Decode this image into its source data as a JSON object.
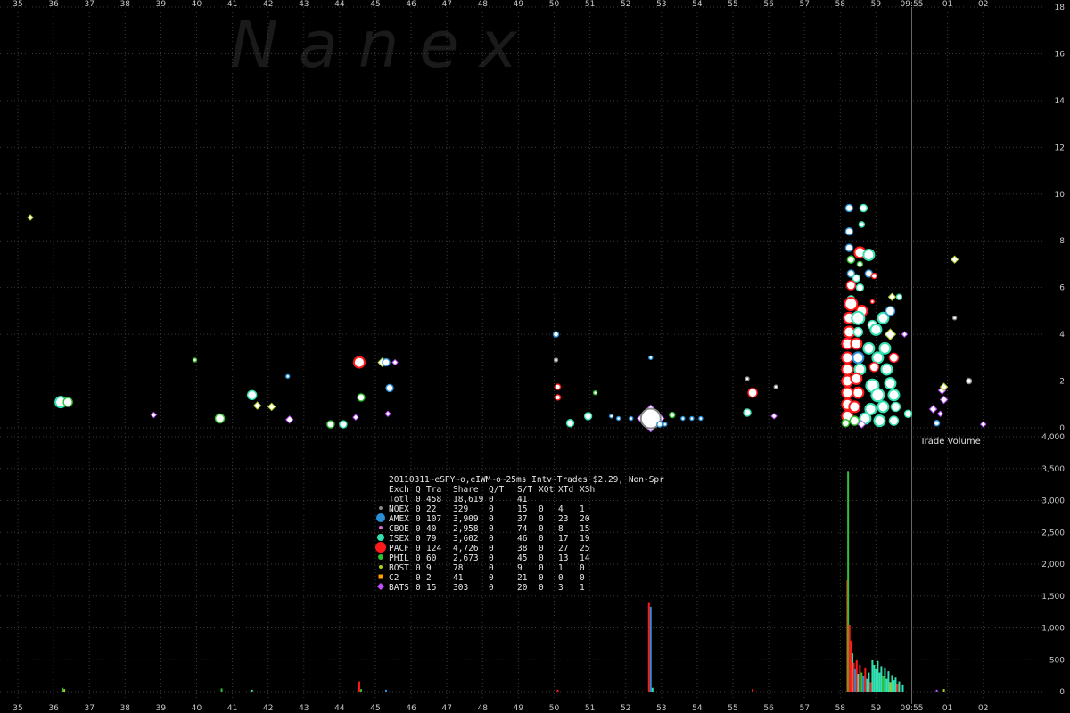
{
  "watermark": "N a n e x",
  "chart_data": {
    "type": "scatter",
    "title": "20110311~eSPY~o,eIWM~o~25ms Intv~Trades $2.29, Non-Spr",
    "time_axis": {
      "ticks": [
        "35",
        "36",
        "37",
        "38",
        "39",
        "40",
        "41",
        "42",
        "43",
        "44",
        "45",
        "46",
        "47",
        "48",
        "49",
        "50",
        "51",
        "52",
        "53",
        "54",
        "55",
        "56",
        "57",
        "58",
        "59",
        "09:55",
        "01",
        "02"
      ],
      "start_minute": 35,
      "end_minute": 62.3
    },
    "price_axis": {
      "ticks": [
        "0",
        "2",
        "4",
        "6",
        "8",
        "10",
        "12",
        "14",
        "16",
        "18"
      ],
      "ylim": [
        0,
        18
      ]
    },
    "volume_axis": {
      "label": "Trade Volume",
      "ticks": [
        "0",
        "500",
        "1,000",
        "1,500",
        "2,000",
        "2,500",
        "3,000",
        "3,500",
        "4,000"
      ],
      "ylim": [
        0,
        4000
      ]
    },
    "exchanges": [
      {
        "code": "NQEX",
        "color": "#888888",
        "size": 3
      },
      {
        "code": "AMEX",
        "color": "#2a8fd6",
        "size": 6
      },
      {
        "code": "CBOE",
        "color": "#d66ad6",
        "size": 3
      },
      {
        "code": "ISEX",
        "color": "#33e0b0",
        "size": 5
      },
      {
        "code": "PACF",
        "color": "#ff1a1a",
        "size": 7
      },
      {
        "code": "PHIL",
        "color": "#2ec22e",
        "size": 4
      },
      {
        "code": "BOST",
        "color": "#b0d020",
        "size": 3
      },
      {
        "code": "C2",
        "color": "#ffa000",
        "size": 3
      },
      {
        "code": "BATS",
        "color": "#c050ff",
        "size": 3
      }
    ],
    "stats": {
      "header": [
        "Exch",
        "Q",
        "Tra",
        "Share",
        "Q/T",
        "S/T",
        "XQt",
        "XTd",
        "XSh"
      ],
      "rows": [
        [
          "Totl",
          "0",
          "458",
          "18,619",
          "0",
          "41",
          "",
          "",
          ""
        ],
        [
          "NQEX",
          "0",
          "22",
          "329",
          "0",
          "15",
          "0",
          "4",
          "1"
        ],
        [
          "AMEX",
          "0",
          "107",
          "3,909",
          "0",
          "37",
          "0",
          "23",
          "20"
        ],
        [
          "CBOE",
          "0",
          "40",
          "2,958",
          "0",
          "74",
          "0",
          "8",
          "15"
        ],
        [
          "ISEX",
          "0",
          "79",
          "3,602",
          "0",
          "46",
          "0",
          "17",
          "19"
        ],
        [
          "PACF",
          "0",
          "124",
          "4,726",
          "0",
          "38",
          "0",
          "27",
          "25"
        ],
        [
          "PHIL",
          "0",
          "60",
          "2,673",
          "0",
          "45",
          "0",
          "13",
          "14"
        ],
        [
          "BOST",
          "0",
          "9",
          "78",
          "0",
          "9",
          "0",
          "1",
          "0"
        ],
        [
          "C2",
          "0",
          "2",
          "41",
          "0",
          "21",
          "0",
          "0",
          "0"
        ],
        [
          "BATS",
          "0",
          "15",
          "303",
          "0",
          "20",
          "0",
          "3",
          "1"
        ]
      ]
    },
    "price_points": [
      {
        "t": 35.35,
        "p": 9.0,
        "ex": "BOST",
        "s": 2
      },
      {
        "t": 36.2,
        "p": 1.1,
        "ex": "ISEX",
        "s": 6
      },
      {
        "t": 36.4,
        "p": 1.1,
        "ex": "PHIL",
        "s": 5
      },
      {
        "t": 38.8,
        "p": 0.55,
        "ex": "BATS",
        "s": 2
      },
      {
        "t": 39.95,
        "p": 2.9,
        "ex": "PHIL",
        "s": 2
      },
      {
        "t": 40.65,
        "p": 0.4,
        "ex": "PHIL",
        "s": 5
      },
      {
        "t": 41.55,
        "p": 1.4,
        "ex": "ISEX",
        "s": 5
      },
      {
        "t": 41.7,
        "p": 0.95,
        "ex": "BOST",
        "s": 3
      },
      {
        "t": 42.1,
        "p": 0.9,
        "ex": "BOST",
        "s": 3
      },
      {
        "t": 42.55,
        "p": 2.2,
        "ex": "AMEX",
        "s": 2
      },
      {
        "t": 42.6,
        "p": 0.35,
        "ex": "BATS",
        "s": 3
      },
      {
        "t": 43.75,
        "p": 0.15,
        "ex": "PHIL",
        "s": 4
      },
      {
        "t": 44.1,
        "p": 0.15,
        "ex": "ISEX",
        "s": 4
      },
      {
        "t": 44.45,
        "p": 0.45,
        "ex": "BATS",
        "s": 2
      },
      {
        "t": 44.55,
        "p": 2.8,
        "ex": "PACF",
        "s": 6
      },
      {
        "t": 44.6,
        "p": 1.3,
        "ex": "PHIL",
        "s": 4
      },
      {
        "t": 45.2,
        "p": 2.8,
        "ex": "BOST",
        "s": 4
      },
      {
        "t": 45.3,
        "p": 2.8,
        "ex": "AMEX",
        "s": 4
      },
      {
        "t": 45.4,
        "p": 1.7,
        "ex": "AMEX",
        "s": 4
      },
      {
        "t": 45.35,
        "p": 0.6,
        "ex": "BATS",
        "s": 2
      },
      {
        "t": 45.55,
        "p": 2.8,
        "ex": "BATS",
        "s": 2
      },
      {
        "t": 50.05,
        "p": 4.0,
        "ex": "AMEX",
        "s": 3
      },
      {
        "t": 50.05,
        "p": 2.9,
        "ex": "NQEX",
        "s": 2
      },
      {
        "t": 50.1,
        "p": 1.75,
        "ex": "PACF",
        "s": 3
      },
      {
        "t": 50.1,
        "p": 1.3,
        "ex": "PACF",
        "s": 3
      },
      {
        "t": 50.45,
        "p": 0.2,
        "ex": "ISEX",
        "s": 4
      },
      {
        "t": 50.95,
        "p": 0.5,
        "ex": "ISEX",
        "s": 4
      },
      {
        "t": 51.15,
        "p": 1.5,
        "ex": "PHIL",
        "s": 2
      },
      {
        "t": 51.6,
        "p": 0.5,
        "ex": "AMEX",
        "s": 2
      },
      {
        "t": 51.8,
        "p": 0.4,
        "ex": "AMEX",
        "s": 2
      },
      {
        "t": 52.15,
        "p": 0.4,
        "ex": "AMEX",
        "s": 2
      },
      {
        "t": 52.7,
        "p": 0.4,
        "ex": "BATS",
        "s": 14
      },
      {
        "t": 52.7,
        "p": 0.4,
        "ex": "NQEX",
        "s": 11
      },
      {
        "t": 52.7,
        "p": 3.0,
        "ex": "AMEX",
        "s": 2
      },
      {
        "t": 52.95,
        "p": 0.15,
        "ex": "AMEX",
        "s": 3
      },
      {
        "t": 53.1,
        "p": 0.15,
        "ex": "AMEX",
        "s": 2
      },
      {
        "t": 53.3,
        "p": 0.55,
        "ex": "PHIL",
        "s": 3
      },
      {
        "t": 53.6,
        "p": 0.4,
        "ex": "AMEX",
        "s": 2
      },
      {
        "t": 53.85,
        "p": 0.4,
        "ex": "AMEX",
        "s": 2
      },
      {
        "t": 54.1,
        "p": 0.4,
        "ex": "AMEX",
        "s": 2
      },
      {
        "t": 55.4,
        "p": 0.65,
        "ex": "ISEX",
        "s": 4
      },
      {
        "t": 55.4,
        "p": 2.1,
        "ex": "NQEX",
        "s": 2
      },
      {
        "t": 55.55,
        "p": 1.5,
        "ex": "PACF",
        "s": 5
      },
      {
        "t": 56.15,
        "p": 0.5,
        "ex": "BATS",
        "s": 2
      },
      {
        "t": 56.2,
        "p": 1.75,
        "ex": "NQEX",
        "s": 2
      },
      {
        "t": 58.25,
        "p": 9.4,
        "ex": "AMEX",
        "s": 4
      },
      {
        "t": 58.65,
        "p": 9.4,
        "ex": "ISEX",
        "s": 4
      },
      {
        "t": 58.6,
        "p": 8.7,
        "ex": "ISEX",
        "s": 3
      },
      {
        "t": 58.25,
        "p": 8.4,
        "ex": "AMEX",
        "s": 4
      },
      {
        "t": 58.25,
        "p": 7.7,
        "ex": "AMEX",
        "s": 4
      },
      {
        "t": 58.55,
        "p": 7.5,
        "ex": "PACF",
        "s": 6
      },
      {
        "t": 58.8,
        "p": 7.4,
        "ex": "ISEX",
        "s": 6
      },
      {
        "t": 58.3,
        "p": 7.2,
        "ex": "PHIL",
        "s": 4
      },
      {
        "t": 58.55,
        "p": 7.0,
        "ex": "PHIL",
        "s": 3
      },
      {
        "t": 58.3,
        "p": 6.6,
        "ex": "AMEX",
        "s": 4
      },
      {
        "t": 58.8,
        "p": 6.6,
        "ex": "AMEX",
        "s": 4
      },
      {
        "t": 58.95,
        "p": 6.5,
        "ex": "PACF",
        "s": 3
      },
      {
        "t": 58.45,
        "p": 6.4,
        "ex": "ISEX",
        "s": 4
      },
      {
        "t": 58.3,
        "p": 6.1,
        "ex": "PACF",
        "s": 5
      },
      {
        "t": 58.55,
        "p": 6.0,
        "ex": "ISEX",
        "s": 4
      },
      {
        "t": 58.3,
        "p": 5.5,
        "ex": "ISEX",
        "s": 4
      },
      {
        "t": 58.9,
        "p": 5.4,
        "ex": "PACF",
        "s": 2
      },
      {
        "t": 59.45,
        "p": 5.6,
        "ex": "BOST",
        "s": 3
      },
      {
        "t": 59.65,
        "p": 5.6,
        "ex": "ISEX",
        "s": 3
      },
      {
        "t": 58.3,
        "p": 5.3,
        "ex": "PACF",
        "s": 7
      },
      {
        "t": 58.6,
        "p": 5.0,
        "ex": "PACF",
        "s": 6
      },
      {
        "t": 58.25,
        "p": 4.7,
        "ex": "PACF",
        "s": 6
      },
      {
        "t": 58.5,
        "p": 4.7,
        "ex": "ISEX",
        "s": 7
      },
      {
        "t": 59.2,
        "p": 4.7,
        "ex": "ISEX",
        "s": 6
      },
      {
        "t": 59.4,
        "p": 5.0,
        "ex": "AMEX",
        "s": 5
      },
      {
        "t": 58.9,
        "p": 4.4,
        "ex": "ISEX",
        "s": 5
      },
      {
        "t": 58.25,
        "p": 4.1,
        "ex": "PACF",
        "s": 6
      },
      {
        "t": 58.5,
        "p": 4.1,
        "ex": "ISEX",
        "s": 5
      },
      {
        "t": 59.0,
        "p": 4.2,
        "ex": "ISEX",
        "s": 6
      },
      {
        "t": 59.4,
        "p": 4.0,
        "ex": "BOST",
        "s": 5
      },
      {
        "t": 59.8,
        "p": 4.0,
        "ex": "BATS",
        "s": 2
      },
      {
        "t": 58.2,
        "p": 3.6,
        "ex": "PACF",
        "s": 6
      },
      {
        "t": 58.45,
        "p": 3.6,
        "ex": "PACF",
        "s": 6
      },
      {
        "t": 58.8,
        "p": 3.4,
        "ex": "ISEX",
        "s": 6
      },
      {
        "t": 59.25,
        "p": 3.4,
        "ex": "ISEX",
        "s": 6
      },
      {
        "t": 58.2,
        "p": 3.0,
        "ex": "PACF",
        "s": 6
      },
      {
        "t": 58.5,
        "p": 3.0,
        "ex": "AMEX",
        "s": 6
      },
      {
        "t": 59.05,
        "p": 3.0,
        "ex": "ISEX",
        "s": 6
      },
      {
        "t": 59.5,
        "p": 3.0,
        "ex": "PACF",
        "s": 5
      },
      {
        "t": 58.2,
        "p": 2.5,
        "ex": "PACF",
        "s": 6
      },
      {
        "t": 58.55,
        "p": 2.5,
        "ex": "ISEX",
        "s": 6
      },
      {
        "t": 58.95,
        "p": 2.6,
        "ex": "PACF",
        "s": 5
      },
      {
        "t": 59.3,
        "p": 2.5,
        "ex": "ISEX",
        "s": 6
      },
      {
        "t": 58.2,
        "p": 2.0,
        "ex": "PACF",
        "s": 6
      },
      {
        "t": 58.45,
        "p": 2.1,
        "ex": "PACF",
        "s": 6
      },
      {
        "t": 58.9,
        "p": 1.8,
        "ex": "ISEX",
        "s": 7
      },
      {
        "t": 59.4,
        "p": 1.9,
        "ex": "ISEX",
        "s": 6
      },
      {
        "t": 58.2,
        "p": 1.5,
        "ex": "PACF",
        "s": 6
      },
      {
        "t": 58.5,
        "p": 1.5,
        "ex": "PACF",
        "s": 6
      },
      {
        "t": 59.05,
        "p": 1.4,
        "ex": "ISEX",
        "s": 7
      },
      {
        "t": 59.5,
        "p": 1.4,
        "ex": "ISEX",
        "s": 6
      },
      {
        "t": 58.2,
        "p": 1.0,
        "ex": "PACF",
        "s": 6
      },
      {
        "t": 58.4,
        "p": 0.9,
        "ex": "PACF",
        "s": 6
      },
      {
        "t": 58.85,
        "p": 0.8,
        "ex": "ISEX",
        "s": 6
      },
      {
        "t": 59.2,
        "p": 0.9,
        "ex": "ISEX",
        "s": 6
      },
      {
        "t": 59.55,
        "p": 0.9,
        "ex": "ISEX",
        "s": 5
      },
      {
        "t": 58.2,
        "p": 0.5,
        "ex": "PACF",
        "s": 6
      },
      {
        "t": 58.4,
        "p": 0.3,
        "ex": "PHIL",
        "s": 5
      },
      {
        "t": 58.7,
        "p": 0.4,
        "ex": "ISEX",
        "s": 6
      },
      {
        "t": 59.1,
        "p": 0.3,
        "ex": "ISEX",
        "s": 6
      },
      {
        "t": 59.5,
        "p": 0.3,
        "ex": "ISEX",
        "s": 5
      },
      {
        "t": 58.15,
        "p": 0.2,
        "ex": "PHIL",
        "s": 4
      },
      {
        "t": 58.6,
        "p": 0.15,
        "ex": "BATS",
        "s": 3
      },
      {
        "t": 59.9,
        "p": 0.6,
        "ex": "ISEX",
        "s": 4
      },
      {
        "t": 60.6,
        "p": 0.8,
        "ex": "BATS",
        "s": 3
      },
      {
        "t": 60.7,
        "p": 0.2,
        "ex": "AMEX",
        "s": 3
      },
      {
        "t": 60.8,
        "p": 0.6,
        "ex": "BATS",
        "s": 2
      },
      {
        "t": 60.85,
        "p": 1.6,
        "ex": "BATS",
        "s": 3
      },
      {
        "t": 60.9,
        "p": 1.75,
        "ex": "BOST",
        "s": 3
      },
      {
        "t": 60.9,
        "p": 1.2,
        "ex": "BATS",
        "s": 3
      },
      {
        "t": 61.2,
        "p": 7.2,
        "ex": "BOST",
        "s": 3
      },
      {
        "t": 61.2,
        "p": 4.7,
        "ex": "NQEX",
        "s": 2
      },
      {
        "t": 61.6,
        "p": 2.0,
        "ex": "NQEX",
        "s": 3
      },
      {
        "t": 62.0,
        "p": 0.15,
        "ex": "BATS",
        "s": 2
      }
    ],
    "volume_bars": [
      {
        "t": 36.25,
        "v": 60,
        "ex": "PHIL"
      },
      {
        "t": 36.3,
        "v": 40,
        "ex": "BOST"
      },
      {
        "t": 40.7,
        "v": 50,
        "ex": "PHIL"
      },
      {
        "t": 41.55,
        "v": 30,
        "ex": "ISEX"
      },
      {
        "t": 44.55,
        "v": 160,
        "ex": "PACF"
      },
      {
        "t": 44.6,
        "v": 40,
        "ex": "PHIL"
      },
      {
        "t": 45.3,
        "v": 30,
        "ex": "AMEX"
      },
      {
        "t": 50.1,
        "v": 30,
        "ex": "PACF"
      },
      {
        "t": 52.65,
        "v": 1390,
        "ex": "PACF"
      },
      {
        "t": 52.7,
        "v": 1330,
        "ex": "AMEX"
      },
      {
        "t": 52.75,
        "v": 60,
        "ex": "ISEX"
      },
      {
        "t": 55.55,
        "v": 40,
        "ex": "PACF"
      },
      {
        "t": 58.2,
        "v": 1750,
        "ex": "PACF"
      },
      {
        "t": 58.22,
        "v": 3450,
        "ex": "PHIL"
      },
      {
        "t": 58.26,
        "v": 1050,
        "ex": "PACF"
      },
      {
        "t": 58.3,
        "v": 800,
        "ex": "PACF"
      },
      {
        "t": 58.34,
        "v": 600,
        "ex": "ISEX"
      },
      {
        "t": 58.38,
        "v": 450,
        "ex": "PACF"
      },
      {
        "t": 58.42,
        "v": 350,
        "ex": "AMEX"
      },
      {
        "t": 58.46,
        "v": 500,
        "ex": "PACF"
      },
      {
        "t": 58.5,
        "v": 280,
        "ex": "ISEX"
      },
      {
        "t": 58.55,
        "v": 420,
        "ex": "PACF"
      },
      {
        "t": 58.6,
        "v": 300,
        "ex": "PHIL"
      },
      {
        "t": 58.65,
        "v": 250,
        "ex": "AMEX"
      },
      {
        "t": 58.7,
        "v": 380,
        "ex": "PACF"
      },
      {
        "t": 58.75,
        "v": 200,
        "ex": "ISEX"
      },
      {
        "t": 58.8,
        "v": 300,
        "ex": "ISEX"
      },
      {
        "t": 58.85,
        "v": 150,
        "ex": "PACF"
      },
      {
        "t": 58.9,
        "v": 500,
        "ex": "ISEX"
      },
      {
        "t": 58.95,
        "v": 420,
        "ex": "ISEX"
      },
      {
        "t": 59.0,
        "v": 350,
        "ex": "ISEX"
      },
      {
        "t": 59.05,
        "v": 480,
        "ex": "ISEX"
      },
      {
        "t": 59.1,
        "v": 300,
        "ex": "ISEX"
      },
      {
        "t": 59.15,
        "v": 400,
        "ex": "ISEX"
      },
      {
        "t": 59.2,
        "v": 250,
        "ex": "PHIL"
      },
      {
        "t": 59.25,
        "v": 380,
        "ex": "ISEX"
      },
      {
        "t": 59.3,
        "v": 200,
        "ex": "ISEX"
      },
      {
        "t": 59.35,
        "v": 320,
        "ex": "ISEX"
      },
      {
        "t": 59.4,
        "v": 150,
        "ex": "BOST"
      },
      {
        "t": 59.45,
        "v": 260,
        "ex": "ISEX"
      },
      {
        "t": 59.5,
        "v": 180,
        "ex": "ISEX"
      },
      {
        "t": 59.55,
        "v": 220,
        "ex": "ISEX"
      },
      {
        "t": 59.6,
        "v": 120,
        "ex": "PACF"
      },
      {
        "t": 59.65,
        "v": 160,
        "ex": "ISEX"
      },
      {
        "t": 59.75,
        "v": 100,
        "ex": "ISEX"
      },
      {
        "t": 60.7,
        "v": 30,
        "ex": "BATS"
      },
      {
        "t": 60.9,
        "v": 40,
        "ex": "BOST"
      }
    ]
  }
}
